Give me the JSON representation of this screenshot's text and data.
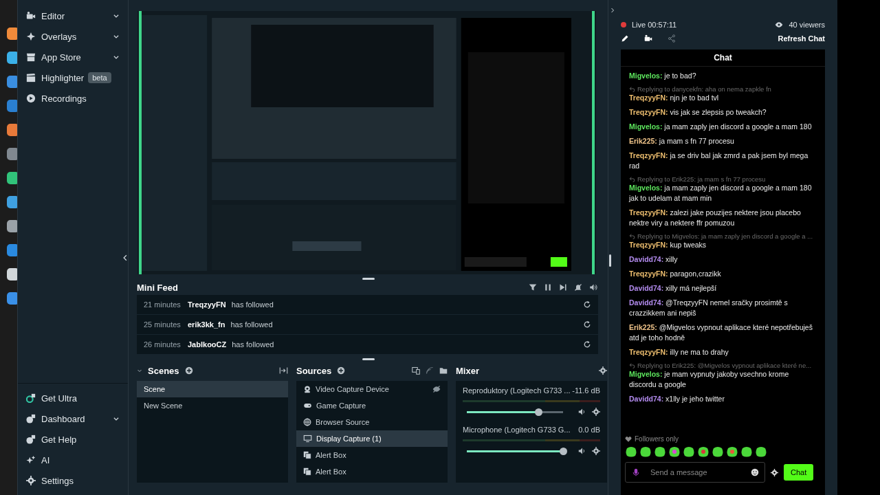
{
  "sidebar": {
    "top_items": [
      {
        "kind": "editor",
        "label": "Editor",
        "expandable": true
      },
      {
        "kind": "overlays",
        "label": "Overlays",
        "expandable": true
      },
      {
        "kind": "store",
        "label": "App Store",
        "expandable": true
      },
      {
        "kind": "highlighter",
        "label": "Highlighter",
        "expandable": false,
        "badge": "beta"
      },
      {
        "kind": "recordings",
        "label": "Recordings",
        "expandable": false
      }
    ],
    "bottom_items": [
      {
        "kind": "ultra",
        "label": "Get Ultra",
        "expandable": false
      },
      {
        "kind": "dashboard",
        "label": "Dashboard",
        "expandable": true
      },
      {
        "kind": "help",
        "label": "Get Help",
        "expandable": false
      },
      {
        "kind": "ai",
        "label": "AI",
        "expandable": false
      },
      {
        "kind": "settings",
        "label": "Settings",
        "expandable": false
      }
    ]
  },
  "mini_feed": {
    "title": "Mini Feed",
    "events": [
      {
        "time": "21 minutes",
        "user": "TreqzyyFN",
        "action": "has followed"
      },
      {
        "time": "25 minutes",
        "user": "erik3kk_fn",
        "action": "has followed"
      },
      {
        "time": "26 minutes",
        "user": "JablkooCZ",
        "action": "has followed"
      }
    ]
  },
  "scenes": {
    "title": "Scenes",
    "items": [
      {
        "label": "Scene",
        "selected": true
      },
      {
        "label": "New Scene",
        "selected": false
      }
    ]
  },
  "sources": {
    "title": "Sources",
    "items": [
      {
        "kind": "webcam",
        "label": "Video Capture Device",
        "selected": false,
        "hidden": true
      },
      {
        "kind": "game",
        "label": "Game Capture",
        "selected": false,
        "hidden": false
      },
      {
        "kind": "browser",
        "label": "Browser Source",
        "selected": false,
        "hidden": false
      },
      {
        "kind": "display",
        "label": "Display Capture (1)",
        "selected": true,
        "hidden": false
      },
      {
        "kind": "alert",
        "label": "Alert Box",
        "selected": false,
        "hidden": false
      },
      {
        "kind": "alert",
        "label": "Alert Box",
        "selected": false,
        "hidden": false
      }
    ]
  },
  "mixer": {
    "title": "Mixer",
    "channels": [
      {
        "name": "Reproduktory (Logitech G733 ...",
        "reading": "-11.6 dB",
        "level": 0.74
      },
      {
        "name": "Microphone (Logitech G733 G...",
        "reading": "0.0 dB",
        "level": 1
      }
    ]
  },
  "stream": {
    "live": "Live 00:57:11",
    "viewers": "40 viewers",
    "refresh": "Refresh Chat"
  },
  "chat": {
    "title": "Chat",
    "messages": [
      {
        "user": "Migvelos:",
        "color": "#5ee85e",
        "text": "je to bad?"
      },
      {
        "user": "TreqzyyFN:",
        "color": "#f0c070",
        "text": "njn je to bad tvl",
        "reply": "Replying to danycekfn: aha on nema zapkle fn"
      },
      {
        "user": "TreqzyyFN:",
        "color": "#f0c070",
        "text": "vis jak se zlepsis po tweakch?"
      },
      {
        "user": "Migvelos:",
        "color": "#5ee85e",
        "text": "ja mam zaply jen discord a google a mam 180"
      },
      {
        "user": "Erik225:",
        "color": "#f0c48a",
        "text": "ja mam s fn 77 procesu"
      },
      {
        "user": "TreqzyyFN:",
        "color": "#f0c070",
        "text": "ja se driv bal jak zmrd a pak jsem byl mega rad"
      },
      {
        "user": "Migvelos:",
        "color": "#5ee85e",
        "text": "ja mam zaply jen discord a google a mam 180 jak to udelam at mam min",
        "reply": "Replying to Erik225: ja mam s fn 77 procesu"
      },
      {
        "user": "TreqzyyFN:",
        "color": "#f0c070",
        "text": "zalezi jake pouzijes nektere jsou placebo nektre viry a nektere ffr pomuzou"
      },
      {
        "user": "TreqzyyFN:",
        "color": "#f0c070",
        "text": "kup tweaks",
        "reply": "Replying to Migvelos: ja mam zaply jen discord a google a ..."
      },
      {
        "user": "Davidd74:",
        "color": "#b48cf0",
        "text": "xilly"
      },
      {
        "user": "TreqzyyFN:",
        "color": "#f0c070",
        "text": "paragon,crazikk"
      },
      {
        "user": "Davidd74:",
        "color": "#b48cf0",
        "text": "xilly má nejlepší"
      },
      {
        "user": "Davidd74:",
        "color": "#b48cf0",
        "text": "@TreqzyyFN nemel sračky prosimtě s crazzikkem ani nepiš"
      },
      {
        "user": "Erik225:",
        "color": "#f0c48a",
        "text": "@Migvelos vypnout aplikace které nepotřebuješ atd je toho hodně"
      },
      {
        "user": "TreqzyyFN:",
        "color": "#f0c070",
        "text": "illy ne ma to drahy"
      },
      {
        "user": "Migvelos:",
        "color": "#5ee85e",
        "text": "je mam vypnuty jakoby vsechno krome discordu a google",
        "reply": "Replying to Erik225: @Migvelos vypnout aplikace které ne..."
      },
      {
        "user": "Davidd74:",
        "color": "#b48cf0",
        "text": "x1lly je jeho twitter"
      }
    ],
    "mode": "Followers only",
    "placeholder": "Send a message",
    "send": "Chat"
  }
}
